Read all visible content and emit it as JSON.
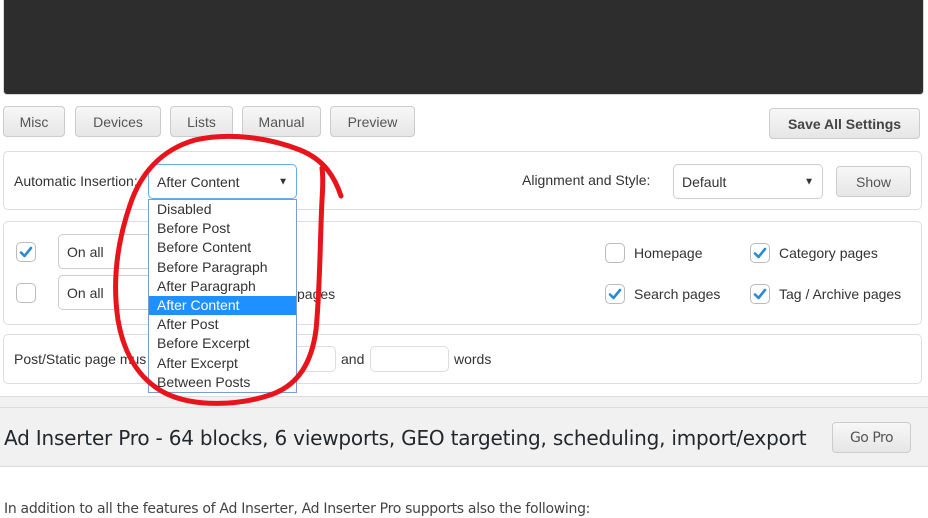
{
  "tabs": [
    {
      "label": "Misc"
    },
    {
      "label": "Devices"
    },
    {
      "label": "Lists"
    },
    {
      "label": "Manual"
    },
    {
      "label": "Preview"
    }
  ],
  "toolbar": {
    "save_label": "Save All Settings"
  },
  "insertion": {
    "label": "Automatic Insertion:",
    "selected": "After Content",
    "options": [
      "Disabled",
      "Before Post",
      "Before Content",
      "Before Paragraph",
      "After Paragraph",
      "After Content",
      "After Post",
      "Before Excerpt",
      "After Excerpt",
      "Between Posts"
    ],
    "selected_index": 5
  },
  "alignment": {
    "label": "Alignment and Style:",
    "selected": "Default",
    "show_label": "Show"
  },
  "filters": {
    "row1": {
      "checked": true,
      "select_value": "On all"
    },
    "row2": {
      "checked": false,
      "select_value": "On all",
      "trailing_text_partial": "pages"
    },
    "pages": [
      {
        "label": "Homepage",
        "checked": false
      },
      {
        "label": "Category pages",
        "checked": true
      },
      {
        "label": "Search pages",
        "checked": true
      },
      {
        "label": "Tag / Archive pages",
        "checked": true
      }
    ]
  },
  "word_count": {
    "label_partial": "Post/Static page mus",
    "and_label": "and",
    "words_label": "words",
    "min_value": "",
    "max_value": ""
  },
  "pro": {
    "title": "Ad Inserter Pro - 64 blocks, 6 viewports, GEO targeting, scheduling, import/export",
    "go_pro_label": "Go Pro",
    "description": "In addition to all the features of Ad Inserter, Ad Inserter Pro supports also the following:"
  },
  "annotation": {
    "color": "#e8141c",
    "shape": "hand-drawn circle around dropdown"
  },
  "colors": {
    "selected_option_bg": "#1e90ff",
    "checkmark": "#2a8ad4",
    "code_area_bg": "#2d2d2d"
  }
}
